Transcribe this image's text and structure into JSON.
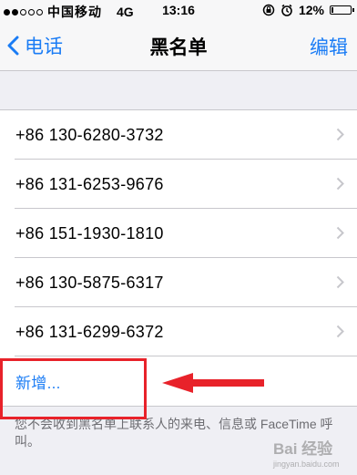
{
  "status_bar": {
    "carrier": "中国移动",
    "network": "4G",
    "time": "13:16",
    "battery": "12%",
    "battery_level": 0.12
  },
  "nav": {
    "back_label": "电话",
    "title": "黑名单",
    "edit_label": "编辑"
  },
  "blocked_numbers": [
    "+86 130-6280-3732",
    "+86 131-6253-9676",
    "+86 151-1930-1810",
    "+86 130-5875-6317",
    "+86 131-6299-6372"
  ],
  "add_label": "新增...",
  "footer_note": "您不会收到黑名单上联系人的来电、信息或 FaceTime 呼叫。",
  "watermark": {
    "text": "Bai 经验",
    "sub": "jingyan.baidu.com"
  },
  "colors": {
    "accent": "#1a7cf5",
    "annotation": "#e8222a",
    "background": "#efeff4"
  }
}
